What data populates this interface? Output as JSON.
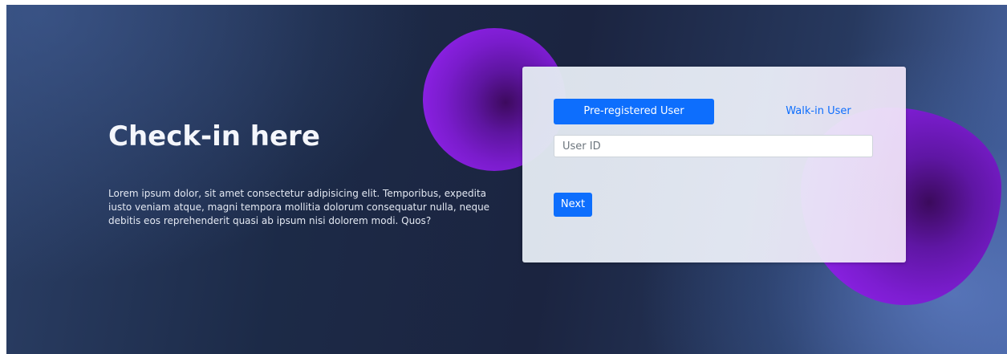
{
  "hero": {
    "title": "Check-in here",
    "description": "Lorem ipsum dolor, sit amet consectetur adipisicing elit. Temporibus, expedita iusto veniam atque, magni tempora mollitia dolorum consequatur nulla, neque debitis eos reprehenderit quasi ab ipsum nisi dolorem modi. Quos?"
  },
  "checkin_form": {
    "tabs": [
      {
        "label": "Pre-registered User",
        "active": true
      },
      {
        "label": "Walk-in User",
        "active": false
      }
    ],
    "user_id": {
      "value": "",
      "placeholder": "User ID"
    },
    "next_label": "Next"
  },
  "colors": {
    "primary": "#0d6efd",
    "blob": "#8d21e6",
    "background_dark": "#1c2a47",
    "background_light": "#4a67a6"
  }
}
